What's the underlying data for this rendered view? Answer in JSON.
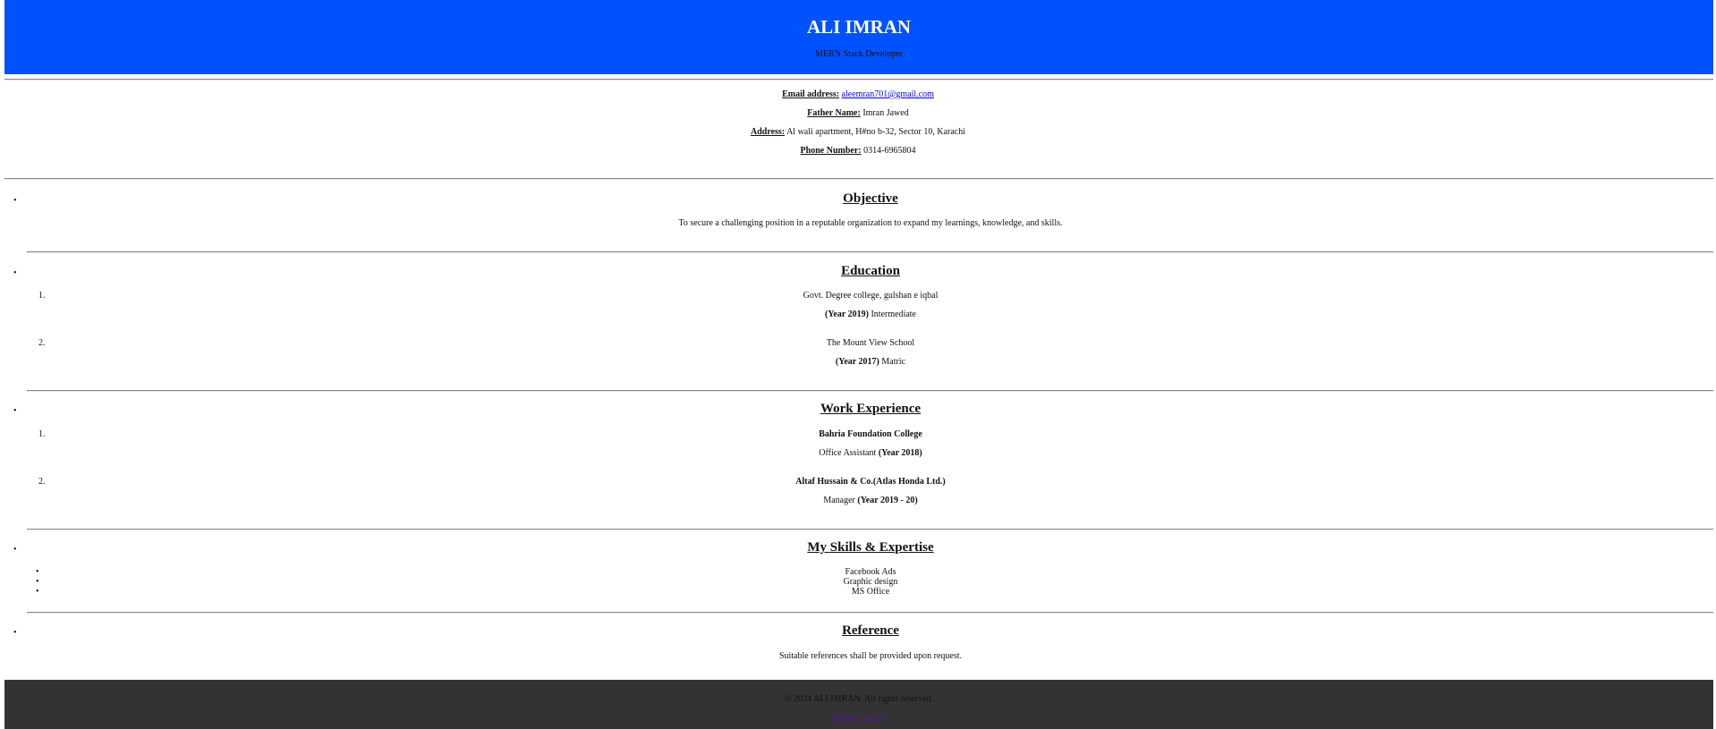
{
  "header": {
    "name": "ALI IMRAN",
    "role": "MERN Stack Developer"
  },
  "contact": {
    "email_label": "Email address:",
    "email_value": "aleemran701@gmail.com",
    "father_label": "Father Name:",
    "father_value": "Imran Jawed",
    "address_label": "Address:",
    "address_value": "Al wali apartment, H#no b-32, Sector 10, Karachi",
    "phone_label": "Phone Number:",
    "phone_value": "0314-6965804"
  },
  "objective": {
    "heading": "Objective",
    "text": "To secure a challenging position in a reputable organization to expand my learnings, knowledge, and skills."
  },
  "education": {
    "heading": "Education",
    "items": [
      {
        "number": "1.",
        "institution": "Govt. Degree college, gulshan e iqbal",
        "year": "(Year 2019)",
        "level": "Intermediate"
      },
      {
        "number": "2.",
        "institution": "The Mount View School",
        "year": "(Year 2017)",
        "level": "Matric"
      }
    ]
  },
  "work": {
    "heading": "Work Experience",
    "items": [
      {
        "number": "1.",
        "company": "Bahria Foundation College",
        "role": "Office Assistant",
        "year": "(Year 2018)"
      },
      {
        "number": "2.",
        "company": "Altaf Hussain & Co.(Atlas Honda Ltd.)",
        "role": "Manager",
        "year": "(Year 2019 - 20)"
      }
    ]
  },
  "skills": {
    "heading": "My Skills & Expertise",
    "items": [
      "Facebook Ads",
      "Graphic design",
      "MS Office"
    ]
  },
  "reference": {
    "heading": "Reference",
    "text": "Suitable references shall be provided upon request."
  },
  "footer": {
    "copyright": "© 2024 ALI IMRAN. All rights reserved.",
    "link": "Privacy Policy"
  },
  "colors": {
    "header_bg": "#0052ff",
    "footer_bg": "#333333",
    "link": "#0000ee"
  }
}
